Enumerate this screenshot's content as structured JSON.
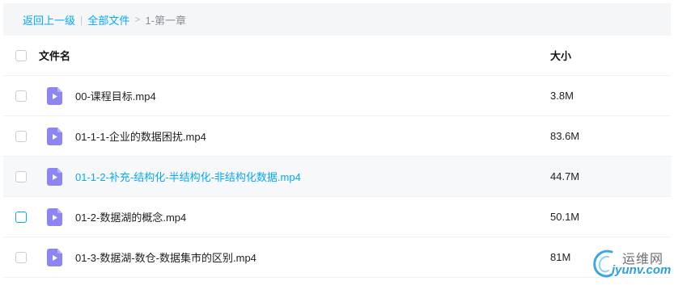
{
  "breadcrumb": {
    "back": "返回上一级",
    "separator": "|",
    "all_files": "全部文件",
    "arrow": ">",
    "current": "1-第一章"
  },
  "table": {
    "col_name": "文件名",
    "col_size": "大小",
    "rows": [
      {
        "name": "00-课程目标.mp4",
        "size": "3.8M"
      },
      {
        "name": "01-1-1-企业的数据困扰.mp4",
        "size": "83.6M"
      },
      {
        "name": "01-1-2-补充-结构化-半结构化-非结构化数据.mp4",
        "size": "44.7M",
        "highlighted": true
      },
      {
        "name": "01-2-数据湖的概念.mp4",
        "size": "50.1M",
        "checkbox_hover": true
      },
      {
        "name": "01-3-数据湖-数仓-数据集市的区别.mp4",
        "size": "81M"
      }
    ]
  },
  "watermark": {
    "cn": "运维网",
    "en": "iyunv.com"
  },
  "colors": {
    "accent": "#06a7ff",
    "file_icon": "#8c85f2",
    "row_highlight": "#f7f8fa"
  },
  "icons": {
    "file": "video-file-icon"
  }
}
